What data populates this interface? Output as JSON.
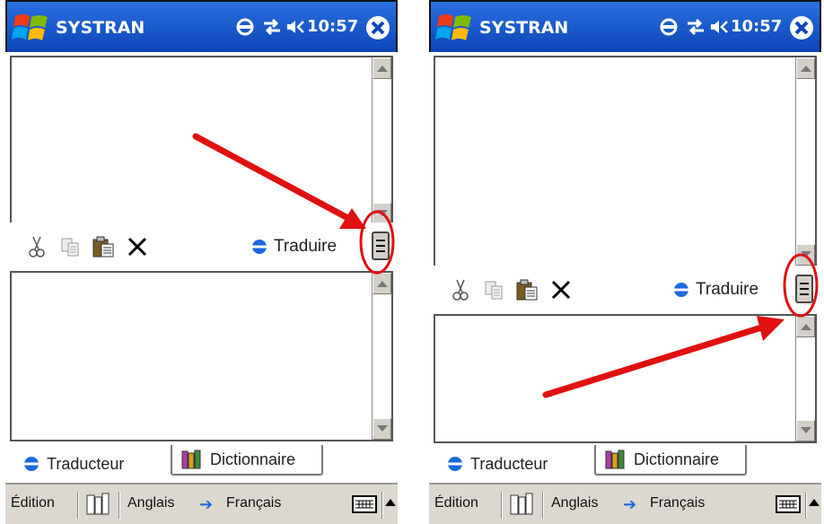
{
  "screens": [
    {
      "title": "SYSTRAN",
      "time": "10:57",
      "translate_label": "Traduire",
      "tabs": {
        "translator": "Traducteur",
        "dictionary": "Dictionnaire"
      },
      "menubar": {
        "edit": "Édition",
        "source_lang": "Anglais",
        "target_lang": "Français",
        "arrow": "➔"
      }
    },
    {
      "title": "SYSTRAN",
      "time": "10:57",
      "translate_label": "Traduire",
      "tabs": {
        "translator": "Traducteur",
        "dictionary": "Dictionnaire"
      },
      "menubar": {
        "edit": "Édition",
        "source_lang": "Anglais",
        "target_lang": "Français",
        "arrow": "➔"
      }
    }
  ],
  "icons": {
    "windows_logo": "windows-start-icon",
    "sync": "systran-sync-icon",
    "connectivity": "connectivity-icon",
    "volume": "volume-icon",
    "close": "close-icon",
    "cut": "cut-icon",
    "copy": "copy-icon",
    "paste": "paste-icon",
    "clear": "clear-icon",
    "splitter": "splitter-handle-icon",
    "keyboard": "keyboard-icon"
  },
  "colors": {
    "titlebar": "#0b46b8",
    "accent_arrow": "#e01010",
    "highlight_circle": "#e01010",
    "lang_arrow": "#1a6ae0"
  }
}
